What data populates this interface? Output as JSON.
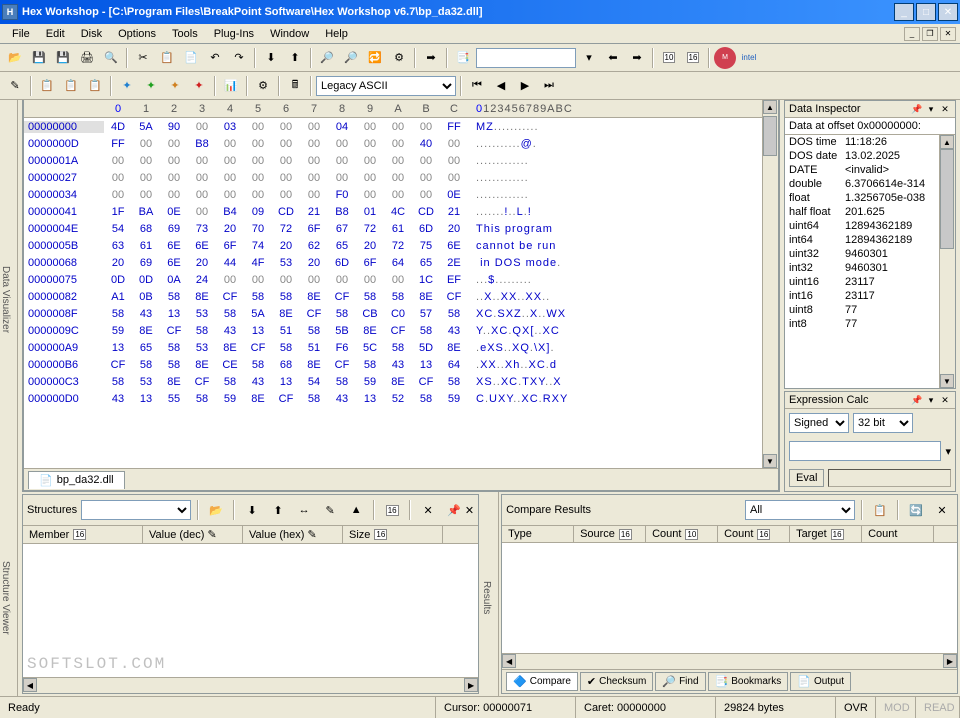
{
  "title": "Hex Workshop - [C:\\Program Files\\BreakPoint Software\\Hex Workshop v6.7\\bp_da32.dll]",
  "menu": [
    "File",
    "Edit",
    "Disk",
    "Options",
    "Tools",
    "Plug-Ins",
    "Window",
    "Help"
  ],
  "toolbar1": {
    "encoding": "Legacy ASCII"
  },
  "hex": {
    "cols": [
      "0",
      "1",
      "2",
      "3",
      "4",
      "5",
      "6",
      "7",
      "8",
      "9",
      "A",
      "B",
      "C"
    ],
    "asc_hdr": "0123456789ABC",
    "rows": [
      {
        "off": "00000000",
        "b": [
          "4D",
          "5A",
          "90",
          "00",
          "03",
          "00",
          "00",
          "00",
          "04",
          "00",
          "00",
          "00",
          "FF"
        ],
        "a": "MZ..........."
      },
      {
        "off": "0000000D",
        "b": [
          "FF",
          "00",
          "00",
          "B8",
          "00",
          "00",
          "00",
          "00",
          "00",
          "00",
          "00",
          "40",
          "00"
        ],
        "a": "...........@."
      },
      {
        "off": "0000001A",
        "b": [
          "00",
          "00",
          "00",
          "00",
          "00",
          "00",
          "00",
          "00",
          "00",
          "00",
          "00",
          "00",
          "00"
        ],
        "a": "............."
      },
      {
        "off": "00000027",
        "b": [
          "00",
          "00",
          "00",
          "00",
          "00",
          "00",
          "00",
          "00",
          "00",
          "00",
          "00",
          "00",
          "00"
        ],
        "a": "............."
      },
      {
        "off": "00000034",
        "b": [
          "00",
          "00",
          "00",
          "00",
          "00",
          "00",
          "00",
          "00",
          "F0",
          "00",
          "00",
          "00",
          "0E"
        ],
        "a": "............."
      },
      {
        "off": "00000041",
        "b": [
          "1F",
          "BA",
          "0E",
          "00",
          "B4",
          "09",
          "CD",
          "21",
          "B8",
          "01",
          "4C",
          "CD",
          "21"
        ],
        "a": ".......!..L.!"
      },
      {
        "off": "0000004E",
        "b": [
          "54",
          "68",
          "69",
          "73",
          "20",
          "70",
          "72",
          "6F",
          "67",
          "72",
          "61",
          "6D",
          "20"
        ],
        "a": "This program "
      },
      {
        "off": "0000005B",
        "b": [
          "63",
          "61",
          "6E",
          "6E",
          "6F",
          "74",
          "20",
          "62",
          "65",
          "20",
          "72",
          "75",
          "6E"
        ],
        "a": "cannot be run"
      },
      {
        "off": "00000068",
        "b": [
          "20",
          "69",
          "6E",
          "20",
          "44",
          "4F",
          "53",
          "20",
          "6D",
          "6F",
          "64",
          "65",
          "2E"
        ],
        "a": " in DOS mode."
      },
      {
        "off": "00000075",
        "b": [
          "0D",
          "0D",
          "0A",
          "24",
          "00",
          "00",
          "00",
          "00",
          "00",
          "00",
          "00",
          "1C",
          "EF"
        ],
        "a": "...$........."
      },
      {
        "off": "00000082",
        "b": [
          "A1",
          "0B",
          "58",
          "8E",
          "CF",
          "58",
          "58",
          "8E",
          "CF",
          "58",
          "58",
          "8E",
          "CF"
        ],
        "a": "..X..XX..XX.."
      },
      {
        "off": "0000008F",
        "b": [
          "58",
          "43",
          "13",
          "53",
          "58",
          "5A",
          "8E",
          "CF",
          "58",
          "CB",
          "C0",
          "57",
          "58"
        ],
        "a": "XC.SXZ..X..WX"
      },
      {
        "off": "0000009C",
        "b": [
          "59",
          "8E",
          "CF",
          "58",
          "43",
          "13",
          "51",
          "58",
          "5B",
          "8E",
          "CF",
          "58",
          "43"
        ],
        "a": "Y..XC.QX[..XC"
      },
      {
        "off": "000000A9",
        "b": [
          "13",
          "65",
          "58",
          "53",
          "8E",
          "CF",
          "58",
          "51",
          "F6",
          "5C",
          "58",
          "5D",
          "8E"
        ],
        "a": ".eXS..XQ.\\X]."
      },
      {
        "off": "000000B6",
        "b": [
          "CF",
          "58",
          "58",
          "8E",
          "CE",
          "58",
          "68",
          "8E",
          "CF",
          "58",
          "43",
          "13",
          "64"
        ],
        "a": ".XX..Xh..XC.d"
      },
      {
        "off": "000000C3",
        "b": [
          "58",
          "53",
          "8E",
          "CF",
          "58",
          "43",
          "13",
          "54",
          "58",
          "59",
          "8E",
          "CF",
          "58"
        ],
        "a": "XS..XC.TXY..X"
      },
      {
        "off": "000000D0",
        "b": [
          "43",
          "13",
          "55",
          "58",
          "59",
          "8E",
          "CF",
          "58",
          "43",
          "13",
          "52",
          "58",
          "59"
        ],
        "a": "C.UXY..XC.RXY"
      }
    ],
    "filetab": "bp_da32.dll"
  },
  "inspector": {
    "title": "Data Inspector",
    "sub": "Data at offset 0x00000000:",
    "rows": [
      {
        "k": "int8",
        "v": "77"
      },
      {
        "k": "uint8",
        "v": "77"
      },
      {
        "k": "int16",
        "v": "23117"
      },
      {
        "k": "uint16",
        "v": "23117"
      },
      {
        "k": "int32",
        "v": "9460301"
      },
      {
        "k": "uint32",
        "v": "9460301"
      },
      {
        "k": "int64",
        "v": "12894362189"
      },
      {
        "k": "uint64",
        "v": "12894362189"
      },
      {
        "k": "half float",
        "v": "201.625"
      },
      {
        "k": "float",
        "v": "1.3256705e-038"
      },
      {
        "k": "double",
        "v": "6.3706614e-314"
      },
      {
        "k": "DATE",
        "v": "<invalid>"
      },
      {
        "k": "DOS date",
        "v": "13.02.2025"
      },
      {
        "k": "DOS time",
        "v": "11:18:26"
      }
    ]
  },
  "expr": {
    "title": "Expression Calc",
    "sel1": "Signed",
    "sel2": "32 bit",
    "btn": "Eval"
  },
  "structures": {
    "title": "Structures",
    "cols": [
      "Member",
      "Value (dec)",
      "Value (hex)",
      "Size"
    ],
    "watermark": "SOFTSLOT.COM"
  },
  "compare": {
    "title": "Compare Results",
    "filter": "All",
    "cols": [
      "Type",
      "Source",
      "Count",
      "Count",
      "Target",
      "Count"
    ],
    "tabs": [
      "Compare",
      "Checksum",
      "Find",
      "Bookmarks",
      "Output"
    ]
  },
  "status": {
    "ready": "Ready",
    "cursor": "Cursor: 00000071",
    "caret": "Caret: 00000000",
    "bytes": "29824 bytes",
    "ovr": "OVR",
    "mod": "MOD",
    "read": "READ"
  },
  "vtabs": {
    "left1": "Data Visualizer",
    "left2": "Structure Viewer",
    "right": "Results"
  }
}
